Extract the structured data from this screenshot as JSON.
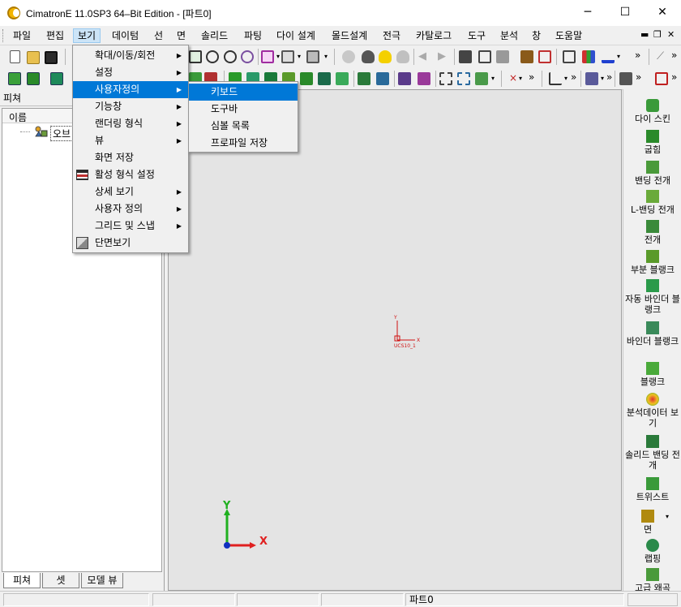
{
  "window": {
    "title": "CimatronE 11.0SP3 64–Bit Edition - [파트0]",
    "controls": {
      "minimize": "─",
      "maximize": "☐",
      "close": "✕"
    }
  },
  "menubar": {
    "items": [
      "파일",
      "편집",
      "보기",
      "데이텀",
      "선",
      "면",
      "솔리드",
      "파팅",
      "다이 설계",
      "몰드설계",
      "전극",
      "카탈로그",
      "도구",
      "분석",
      "창",
      "도움말"
    ],
    "active": "보기",
    "mdi_controls": [
      "▬",
      "❐",
      "✕"
    ]
  },
  "view_menu": {
    "items": [
      {
        "label": "확대/이동/회전",
        "submenu": true,
        "icon": ""
      },
      {
        "label": "설정",
        "submenu": true,
        "icon": ""
      },
      {
        "label": "사용자정의",
        "submenu": true,
        "icon": "",
        "highlighted": true
      },
      {
        "label": "기능창",
        "submenu": true,
        "icon": ""
      },
      {
        "label": "랜더링 형식",
        "submenu": true,
        "icon": ""
      },
      {
        "label": "뷰",
        "submenu": true,
        "icon": ""
      },
      {
        "label": "화면 저장",
        "submenu": false,
        "icon": ""
      },
      {
        "label": "활성 형식 설정",
        "submenu": false,
        "icon": "grid-icon"
      },
      {
        "label": "상세 보기",
        "submenu": true,
        "icon": ""
      },
      {
        "label": "사용자 정의",
        "submenu": true,
        "icon": ""
      },
      {
        "label": "그리드 및 스냅",
        "submenu": true,
        "icon": ""
      },
      {
        "label": "단면보기",
        "submenu": false,
        "icon": "section-view-icon"
      }
    ]
  },
  "customize_submenu": {
    "items": [
      {
        "label": "키보드",
        "highlighted": true
      },
      {
        "label": "도구바",
        "highlighted": false
      },
      {
        "label": "심볼 목록",
        "highlighted": false
      },
      {
        "label": "프로파일 저장",
        "highlighted": false
      }
    ]
  },
  "left_panel": {
    "title": "피쳐",
    "tree_header": "이름",
    "tree_item": "오브",
    "tabs": [
      "피쳐",
      "셋",
      "모델 뷰"
    ]
  },
  "viewport": {
    "ucs_label": "UCS10_1",
    "axis_x": "X",
    "axis_y": "Y"
  },
  "right_toolbar": {
    "items": [
      "다이 스킨",
      "굽힘",
      "밴딩 전개",
      "L-밴딩 전개",
      "전개",
      "부분 블랭크",
      "자동 바인더 블랭크",
      "바인더 블랭크",
      "블랭크",
      "분석데이터 보기",
      "솔리드 밴딩 전개",
      "트위스트",
      "면",
      "랩핑",
      "고급 왜곡"
    ]
  },
  "statusbar": {
    "part_name": "파트0"
  },
  "colors": {
    "accent": "#0078d7",
    "axis_x": "#e02020",
    "axis_y": "#20b020",
    "axis_z": "#1030c0",
    "ucs": "#d01010"
  }
}
